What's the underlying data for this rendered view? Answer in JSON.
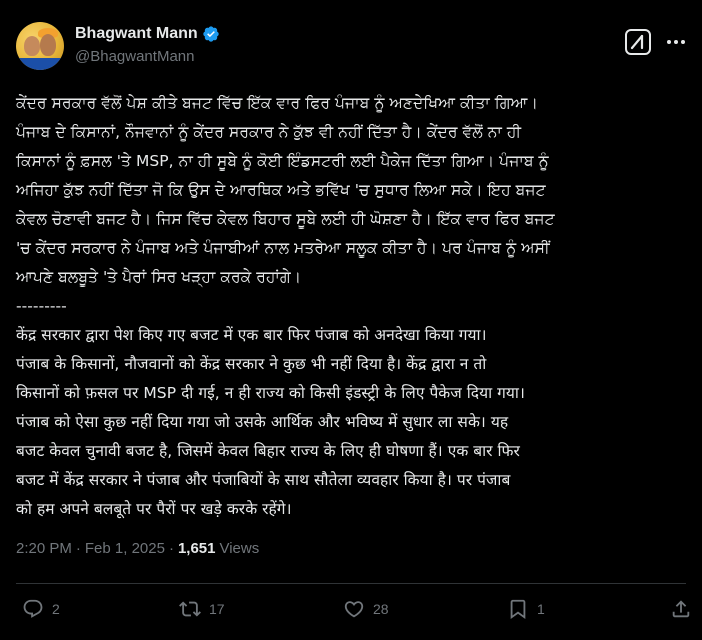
{
  "author": {
    "display_name": "Bhagwant Mann",
    "handle": "@BhagwantMann",
    "avatar_icon": "profile-photo",
    "verified": true
  },
  "header": {
    "grok_icon": "grok-icon",
    "more_icon": "more-icon"
  },
  "tweet": {
    "lines": [
      "ਕੇਂਦਰ ਸਰਕਾਰ ਵੱਲੋਂ ਪੇਸ਼ ਕੀਤੇ ਬਜਟ ਵਿੱਚ ਇੱਕ ਵਾਰ ਫਿਰ ਪੰਜਾਬ ਨੂੰ ਅਣਦੇਖਿਆ ਕੀਤਾ ਗਿਆ।",
      "ਪੰਜਾਬ ਦੇ ਕਿਸਾਨਾਂ, ਨੌਜਵਾਨਾਂ ਨੂੰ ਕੇਂਦਰ ਸਰਕਾਰ ਨੇ ਕੁੱਝ ਵੀ ਨਹੀਂ ਦਿੱਤਾ ਹੈ। ਕੇਂਦਰ ਵੱਲੋਂ ਨਾ ਹੀ",
      "ਕਿਸਾਨਾਂ ਨੂੰ ਫ਼ਸਲ 'ਤੇ MSP, ਨਾ ਹੀ ਸੂਬੇ ਨੂੰ ਕੋਈ ਇੰਡਸਟਰੀ ਲਈ ਪੈਕੇਜ ਦਿੱਤਾ ਗਿਆ। ਪੰਜਾਬ ਨੂੰ",
      "ਅਜਿਹਾ ਕੁੱਝ ਨਹੀਂ ਦਿੱਤਾ ਜੋ ਕਿ ਉਸ ਦੇ ਆਰਥਿਕ ਅਤੇ ਭਵਿੱਖ 'ਚ ਸੁਧਾਰ ਲਿਆ ਸਕੇ। ਇਹ ਬਜਟ",
      "ਕੇਵਲ ਚੋਣਾਵੀ ਬਜਟ ਹੈ। ਜਿਸ ਵਿੱਚ ਕੇਵਲ ਬਿਹਾਰ ਸੂਬੇ ਲਈ ਹੀ ਘੋਸ਼ਣਾ ਹੈ। ਇੱਕ ਵਾਰ ਫਿਰ ਬਜਟ",
      "'ਚ ਕੇਂਦਰ ਸਰਕਾਰ ਨੇ ਪੰਜਾਬ ਅਤੇ ਪੰਜਾਬੀਆਂ ਨਾਲ ਮਤਰੇਆ ਸਲੂਕ ਕੀਤਾ ਹੈ। ਪਰ ਪੰਜਾਬ ਨੂੰ ਅਸੀਂ",
      "ਆਪਣੇ ਬਲਬੂਤੇ 'ਤੇ ਪੈਰਾਂ ਸਿਰ ਖੜ੍ਹਾ ਕਰਕੇ ਰਹਾਂਗੇ।",
      "---------",
      "केंद्र सरकार द्वारा पेश किए गए बजट में एक बार फिर पंजाब को अनदेखा किया गया।",
      "पंजाब के किसानों, नौजवानों को केंद्र सरकार ने कुछ भी नहीं दिया है। केंद्र द्वारा न तो",
      "किसानों को फ़सल पर MSP दी गई, न ही राज्य को किसी इंडस्ट्री के लिए पैकेज दिया गया।",
      "पंजाब को ऐसा कुछ नहीं दिया गया जो उसके आर्थिक और भविष्य में सुधार ला सके। यह",
      "बजट केवल चुनावी बजट है, जिसमें केवल बिहार राज्य के लिए ही घोषणा हैं। एक बार फिर",
      "बजट में केंद्र सरकार ने पंजाब और पंजाबियों के साथ सौतेला व्यवहार किया है। पर पंजाब",
      "को हम अपने बलबूते पर पैरों पर खड़े करके रहेंगे।"
    ]
  },
  "meta": {
    "time": "2:20 PM",
    "separator": "·",
    "date": "Feb 1, 2025",
    "views_count": "1,651",
    "views_label": "Views"
  },
  "actions": {
    "reply_count": "2",
    "repost_count": "17",
    "like_count": "28",
    "bookmark_count": "1"
  },
  "colors": {
    "background": "#000000",
    "text": "#e7e9ea",
    "secondary": "#71767b",
    "verified": "#1d9bf0",
    "divider": "#2f3336"
  }
}
